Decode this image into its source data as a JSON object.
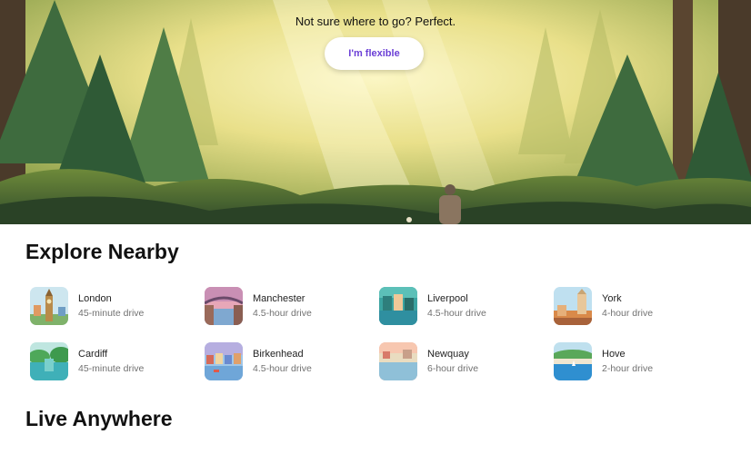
{
  "hero": {
    "tagline": "Not sure where to go? Perfect.",
    "flexible_button": "I'm flexible"
  },
  "explore": {
    "title": "Explore Nearby",
    "destinations": [
      {
        "name": "London",
        "drive": "45-minute drive"
      },
      {
        "name": "Manchester",
        "drive": "4.5-hour drive"
      },
      {
        "name": "Liverpool",
        "drive": "4.5-hour drive"
      },
      {
        "name": "York",
        "drive": "4-hour drive"
      },
      {
        "name": "Cardiff",
        "drive": "45-minute drive"
      },
      {
        "name": "Birkenhead",
        "drive": "4.5-hour drive"
      },
      {
        "name": "Newquay",
        "drive": "6-hour drive"
      },
      {
        "name": "Hove",
        "drive": "2-hour drive"
      }
    ]
  },
  "live": {
    "title": "Live Anywhere"
  },
  "colors": {
    "accent": "#6b3fd6",
    "secondary_text": "#717171"
  }
}
